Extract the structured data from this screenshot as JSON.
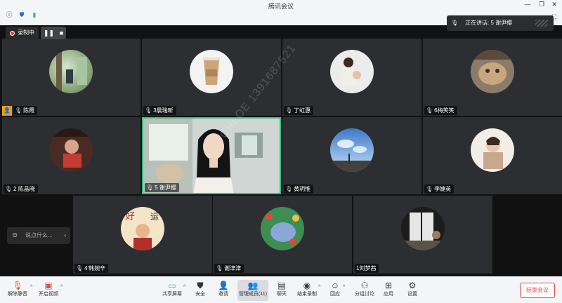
{
  "window": {
    "title": "腾讯会议",
    "controls": [
      "—",
      "❐",
      "✕"
    ]
  },
  "speaking": {
    "label": "正在讲话: 5 谢尹樱"
  },
  "recording": {
    "label": "录制中"
  },
  "participants": [
    {
      "name": "陈霞"
    },
    {
      "name": "3晨瑞昕"
    },
    {
      "name": "丁虹惠"
    },
    {
      "name": "6梅笑笑"
    },
    {
      "name": "2 陈晶晓"
    },
    {
      "name": "5 谢尹樱"
    },
    {
      "name": "黄玥惟"
    },
    {
      "name": "李婕英"
    },
    {
      "name": "4'韩婉辛"
    },
    {
      "name": "谢津津"
    },
    {
      "name": "1刘梦茜"
    }
  ],
  "chat": {
    "placeholder": "说点什么..."
  },
  "watermark": "CHLOE 1391687521",
  "toolbar": {
    "unmute": "解除静音",
    "start_video": "开启视频",
    "share": "共享屏幕",
    "security": "安全",
    "invite": "邀请",
    "members": "管理成员(11)",
    "chat": "聊天",
    "end_record": "结束录制",
    "react": "回应",
    "breakout": "分组讨论",
    "apps": "应用",
    "settings": "设置",
    "end_meeting": "结束会议"
  },
  "colors": {
    "active_border": "#31c27c",
    "end_red": "#e54b4b",
    "host_badge": "#f39c12"
  }
}
